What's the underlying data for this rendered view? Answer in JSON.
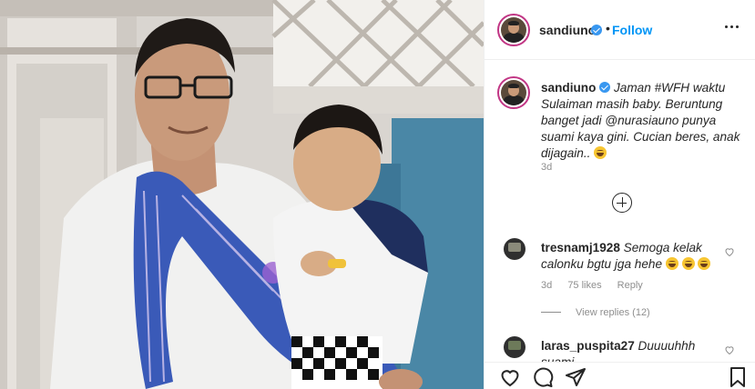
{
  "post": {
    "username": "sandiuno",
    "verified": true,
    "follow_label": "Follow",
    "separator": "•"
  },
  "caption": {
    "username": "sandiuno",
    "text_before": " Jaman ",
    "hashtag": "#WFH",
    "text_middle": " waktu Sulaiman masih baby. Beruntung banget jadi ",
    "mention": "@nurasiauno",
    "text_after": " punya suami kaya gini. Cucian beres, anak dijagain.. ",
    "emoji": "grinning-face-icon",
    "age": "3d"
  },
  "load_more_icon": "plus-circle-icon",
  "comments": [
    {
      "username": "tresnamj1928",
      "text": " Semoga kelak calonku bgtu jga hehe",
      "emojis": [
        "smiling-face-icon",
        "smiling-face-icon",
        "smiling-face-icon"
      ],
      "age": "3d",
      "likes": "75 likes",
      "reply_label": "Reply",
      "view_replies": "View replies (12)"
    },
    {
      "username": "laras_puspita27",
      "text": " Duuuuhhh suami"
    }
  ],
  "actions": {
    "icons": [
      "heart-icon",
      "comment-icon",
      "share-icon",
      "bookmark-icon"
    ]
  },
  "colors": {
    "accent_blue": "#0095f6",
    "verified_blue": "#3897f0",
    "text": "#262626",
    "muted": "#8e8e8e",
    "avatar_ring": "#c13584"
  }
}
